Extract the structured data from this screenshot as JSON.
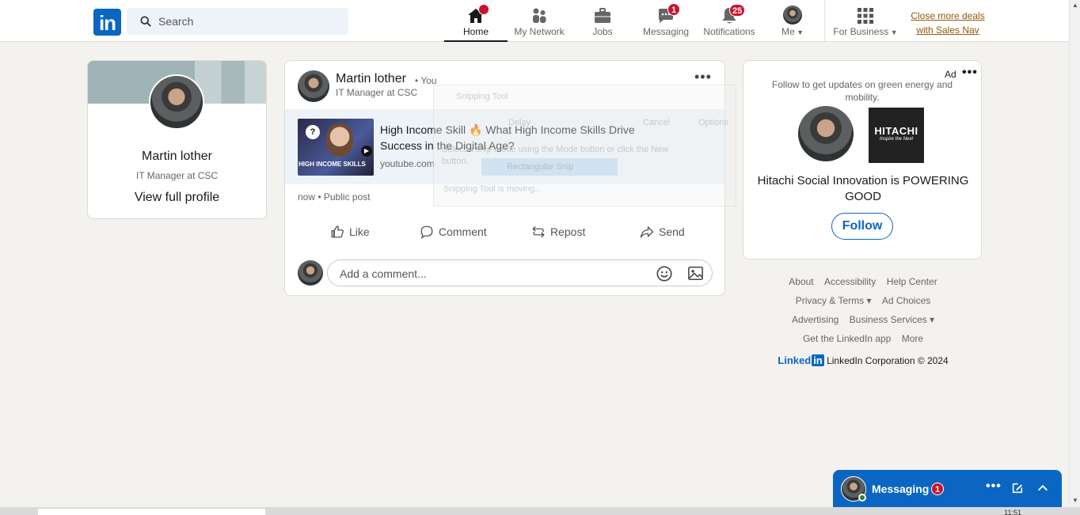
{
  "header": {
    "logo_text": "in",
    "search_placeholder": "Search",
    "nav": [
      {
        "label": "Home",
        "active": true
      },
      {
        "label": "My Network"
      },
      {
        "label": "Jobs"
      },
      {
        "label": "Messaging",
        "badge": "1"
      },
      {
        "label": "Notifications",
        "badge": "25"
      },
      {
        "label": "Me"
      },
      {
        "label": "For Business"
      }
    ],
    "promo_line1": "Close more deals",
    "promo_line2": "with Sales Nav"
  },
  "profile": {
    "name": "Martin lother",
    "headline": "IT Manager at CSC",
    "view_link": "View full profile"
  },
  "post": {
    "author": "Martin lother",
    "you_label": "• You",
    "headline": "IT Manager at CSC",
    "more": "•••",
    "thumb_text": "HIGH INCOME SKILLS",
    "thumb_q": "?",
    "link_title": "High Income Skill 🔥 What High Income Skills Drive Success in the Digital Age?",
    "link_source": "youtube.com",
    "meta": "now • Public post",
    "actions": {
      "like": "Like",
      "comment": "Comment",
      "repost": "Repost",
      "send": "Send"
    },
    "comment_placeholder": "Add a comment..."
  },
  "snipping_tool": {
    "title": "Snipping Tool",
    "delay": "Delay",
    "cancel": "Cancel",
    "options": "Options",
    "hint": "Select a snip mode using the Mode button or click the New button.",
    "mode": "Rectangular Snip",
    "status": "Snipping Tool is moving..."
  },
  "ad": {
    "label": "Ad",
    "more": "•••",
    "description": "Follow to get updates on green energy and mobility.",
    "logo_line1": "HITACHI",
    "logo_line2": "Inspire the Next",
    "headline": "Hitachi Social Innovation is POWERING GOOD",
    "follow": "Follow"
  },
  "footer": {
    "row1": [
      "About",
      "Accessibility",
      "Help Center"
    ],
    "row2": [
      "Privacy & Terms ▾",
      "Ad Choices"
    ],
    "row3": [
      "Advertising",
      "Business Services ▾"
    ],
    "row4": [
      "Get the LinkedIn app",
      "More"
    ],
    "brand_word": "Linked",
    "brand_in": "in",
    "copyright": "LinkedIn Corporation © 2024"
  },
  "messaging_bar": {
    "title": "Messaging",
    "badge": "1",
    "dots": "•••"
  },
  "taskbar": {
    "time": "11:51"
  },
  "colors": {
    "brand": "#0a66c2",
    "badge": "#cb112d",
    "page_bg": "#f4f2ee",
    "promo": "#915907"
  }
}
